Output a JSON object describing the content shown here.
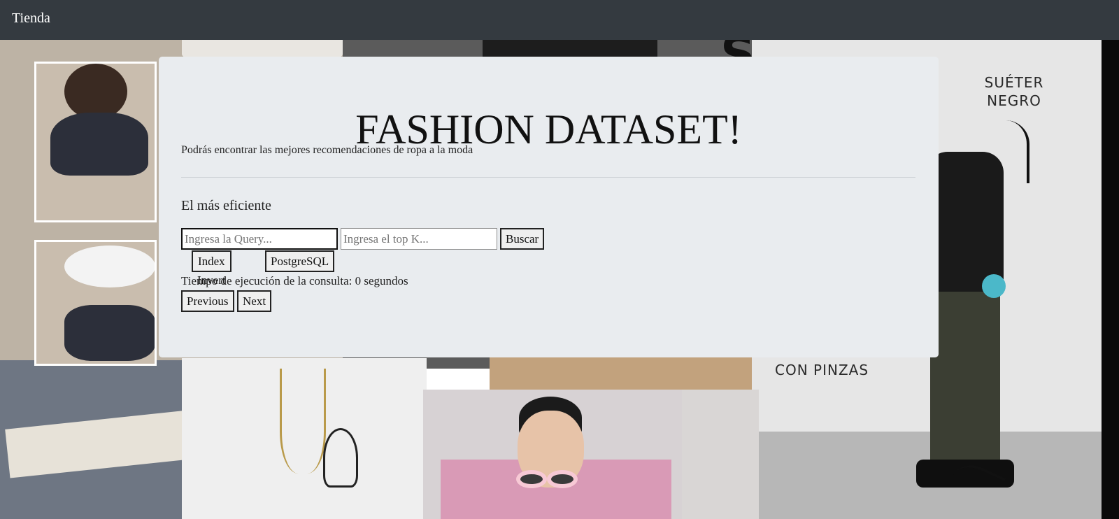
{
  "navbar": {
    "brand": "Tienda"
  },
  "hero": {
    "title": "FASHION DATASET!",
    "lead": "Podrás encontrar las mejores recomendaciones de ropa a la moda",
    "subheading": "El más eficiente"
  },
  "search": {
    "query_placeholder": "Ingresa la Query...",
    "query_value": "",
    "topk_placeholder": "Ingresa el top K...",
    "topk_value": "",
    "submit_label": "Buscar"
  },
  "methods": {
    "index_invert_label": "Index Invert",
    "postgresql_label": "PostgreSQL"
  },
  "results": {
    "exec_time_text": "Tiempo de ejecución de la consulta: 0 segundos"
  },
  "pagination": {
    "previous_label": "Previous",
    "next_label": "Next"
  },
  "background": {
    "caption_sueter": "SUÉTER NEGRO",
    "caption_pinzas": "CON PINZAS",
    "letter_fragment": "S"
  },
  "colors": {
    "navbar": "#343a40",
    "panel": "#e9ecef",
    "accent_dot": "#4bb8c9"
  }
}
